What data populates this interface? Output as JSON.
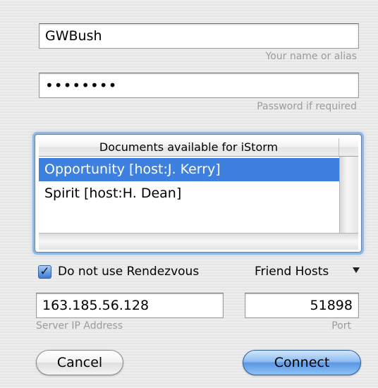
{
  "login": {
    "name_value": "GWBush",
    "name_hint": "Your name or alias",
    "password_value": "••••••••",
    "password_hint": "Password if required"
  },
  "documents": {
    "header": "Documents available for iStorm",
    "items": [
      {
        "label": "Opportunity [host:J. Kerry]",
        "selected": true
      },
      {
        "label": "Spirit [host:H. Dean]",
        "selected": false
      }
    ]
  },
  "options": {
    "rendezvous_label": "Do not use Rendezvous",
    "rendezvous_checked": true,
    "checkmark": "✓",
    "friend_hosts_label": "Friend Hosts"
  },
  "server": {
    "ip_value": "163.185.56.128",
    "ip_label": "Server IP Address",
    "port_value": "51898",
    "port_label": "Port"
  },
  "buttons": {
    "cancel_label": "Cancel",
    "connect_label": "Connect"
  },
  "colors": {
    "selection": "#3d80df",
    "focus_ring": "#8fb8e6",
    "default_button": "#5a97e6"
  },
  "icons": {
    "dropdown": "chevron-down-icon",
    "checkbox": "checkmark-icon"
  }
}
